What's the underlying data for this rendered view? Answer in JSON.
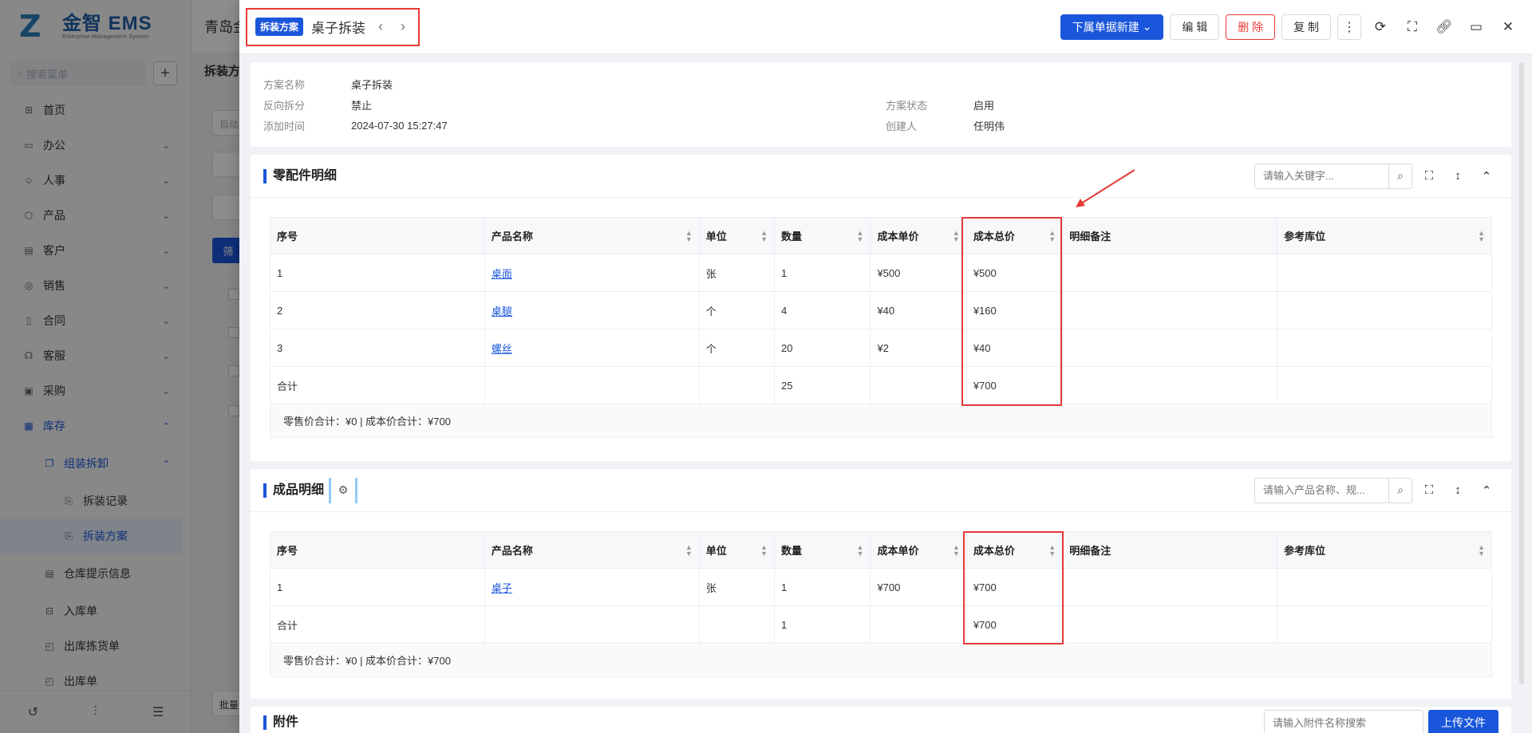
{
  "sidebar": {
    "logo_title": "金智 EMS",
    "logo_subtitle": "Enterprise Management System",
    "search_placeholder": "搜索菜单",
    "items": [
      {
        "label": "首页",
        "icon": "home-icon"
      },
      {
        "label": "办公",
        "icon": "office-icon"
      },
      {
        "label": "人事",
        "icon": "people-icon"
      },
      {
        "label": "产品",
        "icon": "product-icon"
      },
      {
        "label": "客户",
        "icon": "customer-icon"
      },
      {
        "label": "销售",
        "icon": "sales-icon"
      },
      {
        "label": "合同",
        "icon": "contract-icon"
      },
      {
        "label": "客服",
        "icon": "service-icon"
      },
      {
        "label": "采购",
        "icon": "purchase-icon"
      },
      {
        "label": "库存",
        "icon": "inventory-icon"
      },
      {
        "label": "组装拆卸",
        "icon": "assembly-icon"
      },
      {
        "label": "拆装记录",
        "icon": "record-icon"
      },
      {
        "label": "拆装方案",
        "icon": "plan-icon"
      },
      {
        "label": "仓库提示信息",
        "icon": "notice-icon"
      },
      {
        "label": "入库单",
        "icon": "inbound-icon"
      },
      {
        "label": "出库拣货单",
        "icon": "picking-icon"
      },
      {
        "label": "出库单",
        "icon": "outbound-icon"
      }
    ]
  },
  "background": {
    "header_title": "青岛金",
    "page_title": "拆装方",
    "input_placeholder": "自动",
    "filter_btn": "筛",
    "batch_btn": "批量"
  },
  "drawer": {
    "tag": "拆装方案",
    "title": "桌子拆装",
    "buttons": {
      "new_sub": "下属单据新建",
      "edit": "编 辑",
      "delete": "删 除",
      "copy": "复 制"
    },
    "info": {
      "plan_name_label": "方案名称",
      "plan_name": "桌子拆装",
      "reverse_label": "反向拆分",
      "reverse": "禁止",
      "status_label": "方案状态",
      "status": "启用",
      "added_label": "添加时间",
      "added": "2024-07-30 15:27:47",
      "creator_label": "创建人",
      "creator": "任明伟"
    },
    "parts": {
      "title": "零配件明细",
      "search_placeholder": "请输入关键字...",
      "columns": [
        "序号",
        "产品名称",
        "单位",
        "数量",
        "成本单价",
        "成本总价",
        "明细备注",
        "参考库位"
      ],
      "rows": [
        {
          "no": "1",
          "name": "桌面",
          "unit": "张",
          "qty": "1",
          "price": "¥500",
          "total": "¥500",
          "note": "",
          "loc": ""
        },
        {
          "no": "2",
          "name": "桌腿",
          "unit": "个",
          "qty": "4",
          "price": "¥40",
          "total": "¥160",
          "note": "",
          "loc": ""
        },
        {
          "no": "3",
          "name": "螺丝",
          "unit": "个",
          "qty": "20",
          "price": "¥2",
          "total": "¥40",
          "note": "",
          "loc": ""
        }
      ],
      "total_row": {
        "label": "合计",
        "qty": "25",
        "total": "¥700"
      },
      "summary": "零售价合计：¥0 |   成本价合计：¥700"
    },
    "finished": {
      "title": "成品明细",
      "search_placeholder": "请输入产品名称、规...",
      "columns": [
        "序号",
        "产品名称",
        "单位",
        "数量",
        "成本单价",
        "成本总价",
        "明细备注",
        "参考库位"
      ],
      "rows": [
        {
          "no": "1",
          "name": "桌子",
          "unit": "张",
          "qty": "1",
          "price": "¥700",
          "total": "¥700",
          "note": "",
          "loc": ""
        }
      ],
      "total_row": {
        "label": "合计",
        "qty": "1",
        "total": "¥700"
      },
      "summary": "零售价合计：¥0 |   成本价合计：¥700"
    },
    "attachments": {
      "title": "附件",
      "search_placeholder": "请输入附件名称搜索",
      "upload": "上传文件"
    }
  },
  "colors": {
    "primary": "#1a56db",
    "danger": "#e53935",
    "highlight": "#e53935"
  }
}
